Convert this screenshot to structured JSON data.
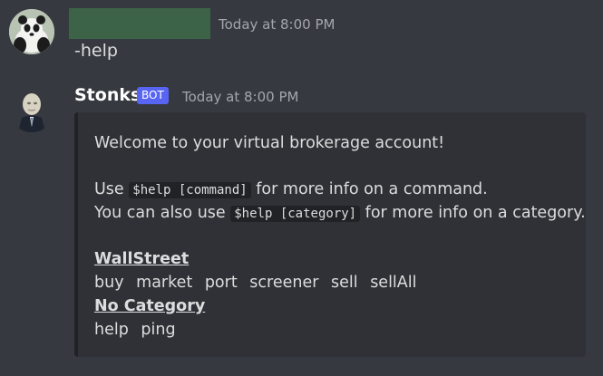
{
  "user_message": {
    "timestamp": "Today at 8:00 PM",
    "text": "-help"
  },
  "bot_message": {
    "name": "Stonks",
    "badge": "BOT",
    "timestamp": "Today at 8:00 PM",
    "embed": {
      "welcome": "Welcome to your virtual brokerage account!",
      "line1_pre": "Use ",
      "line1_code": "$help [command]",
      "line1_post": " for more info on a command.",
      "line2_pre": "You can also use ",
      "line2_code": "$help [category]",
      "line2_post": " for more info on a category.",
      "categories": [
        {
          "title": "WallStreet",
          "commands": [
            "buy",
            "market",
            "port",
            "screener",
            "sell",
            "sellAll"
          ]
        },
        {
          "title": "No Category",
          "commands": [
            "help",
            "ping"
          ]
        }
      ]
    }
  },
  "colors": {
    "background": "#36393f",
    "embed_background": "#2f3136",
    "bot_badge": "#5865f2",
    "timestamp": "#a3a6aa"
  },
  "icons": {
    "user_avatar": "panda-avatar",
    "bot_avatar": "meme-man-avatar"
  }
}
